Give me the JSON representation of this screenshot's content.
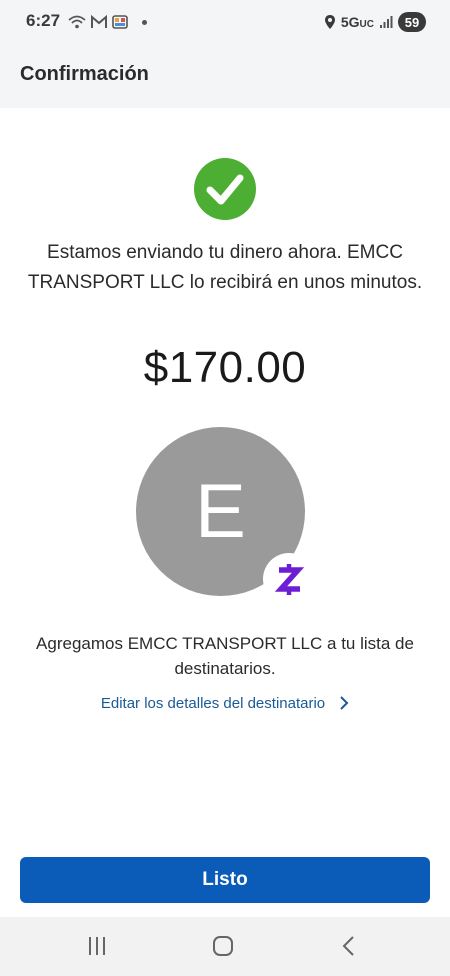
{
  "status_bar": {
    "time": "6:27",
    "network": "5G",
    "network_suffix": "UC",
    "battery": "59",
    "icons": [
      "wifi-calling-icon",
      "gmail-icon",
      "photos-icon",
      "location-icon",
      "signal-icon"
    ]
  },
  "header": {
    "title": "Confirmación"
  },
  "confirmation": {
    "status_icon": "checkmark-icon",
    "accent_color": "#4caf34",
    "message": "Estamos enviando tu dinero ahora. EMCC TRANSPORT LLC lo recibirá en unos minutos.",
    "amount": "$170.00"
  },
  "recipient": {
    "initial": "E",
    "avatar_color": "#9a9a9a",
    "badge_icon": "zelle-icon",
    "badge_color": "#6d1ed4",
    "added_message": "Agregamos EMCC TRANSPORT LLC a tu lista de destinatarios.",
    "edit_link_label": "Editar los detalles del destinatario",
    "link_color": "#1a5a96"
  },
  "actions": {
    "done_label": "Listo",
    "button_color": "#0a5cb8"
  },
  "navigation": {
    "icons": [
      "recent-apps-icon",
      "home-icon",
      "back-icon"
    ]
  }
}
